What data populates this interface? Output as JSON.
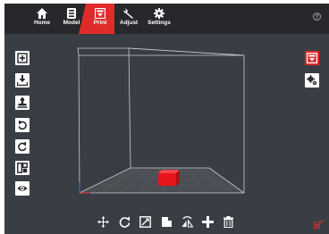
{
  "nav": {
    "items": [
      {
        "label": "Home",
        "icon": "home-icon"
      },
      {
        "label": "Model",
        "icon": "model-icon"
      },
      {
        "label": "Print",
        "icon": "print-icon",
        "active": true
      },
      {
        "label": "Adjust",
        "icon": "wrench-icon"
      },
      {
        "label": "Settings",
        "icon": "gear-icon"
      }
    ],
    "help_icon": "help-icon"
  },
  "left_toolbar": [
    {
      "name": "add-model-button",
      "icon": "add-icon"
    },
    {
      "name": "import-button",
      "icon": "download-tray-icon"
    },
    {
      "name": "stamp-button",
      "icon": "stamp-icon"
    },
    {
      "name": "rotate-left-button",
      "icon": "rotate-left-icon"
    },
    {
      "name": "rotate-right-button",
      "icon": "rotate-right-icon"
    },
    {
      "name": "layout-button",
      "icon": "layout-icon"
    },
    {
      "name": "view-button",
      "icon": "eye-icon"
    }
  ],
  "right_toolbar": [
    {
      "name": "print-panel-button",
      "icon": "print-icon",
      "active": true
    },
    {
      "name": "print-settings-button",
      "icon": "gears-icon"
    }
  ],
  "bottom_toolbar": [
    {
      "name": "move-tool",
      "icon": "move-icon"
    },
    {
      "name": "rotate-tool",
      "icon": "rotate-icon"
    },
    {
      "name": "scale-tool",
      "icon": "scale-icon"
    },
    {
      "name": "lay-flat-tool",
      "icon": "lay-flat-icon"
    },
    {
      "name": "mirror-tool",
      "icon": "mirror-icon"
    },
    {
      "name": "support-tool",
      "icon": "support-icon"
    },
    {
      "name": "delete-tool",
      "icon": "trash-icon"
    }
  ],
  "colors": {
    "accent": "#e02b2b",
    "topbar": "#26282c",
    "workspace": "#393d44",
    "bed": "#4a4d52",
    "model": "#e8141e"
  }
}
